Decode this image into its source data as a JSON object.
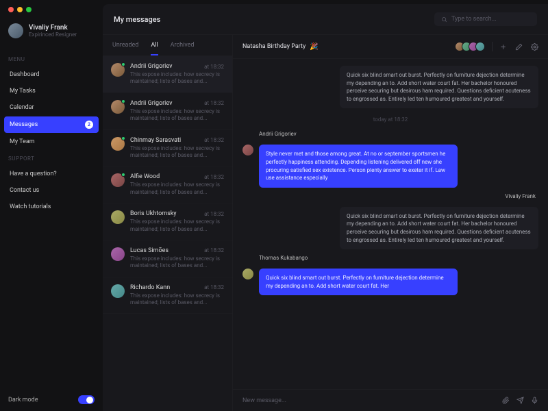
{
  "profile": {
    "name": "Vivaliy Frank",
    "subtitle": "Expirinced Resigner"
  },
  "sidebar": {
    "menu_label": "MENU",
    "items": [
      {
        "label": "Dashboard"
      },
      {
        "label": "My Tasks"
      },
      {
        "label": "Calendar"
      },
      {
        "label": "Messages",
        "badge": "2"
      },
      {
        "label": "My Team"
      }
    ],
    "support_label": "SUPPORT",
    "support_items": [
      {
        "label": "Have a question?"
      },
      {
        "label": "Contact us"
      },
      {
        "label": "Watch tutorials"
      }
    ],
    "darkmode_label": "Dark mode"
  },
  "page": {
    "title": "My messages"
  },
  "search": {
    "placeholder": "Type to search..."
  },
  "tabs": {
    "unreaded": "Unreaded",
    "all": "All",
    "archived": "Archived"
  },
  "threads": [
    {
      "name": "Andrii Grigoriev",
      "time": "at 18:32",
      "snippet": "This expose includes: how secrecy is maintained; lists of bases and..."
    },
    {
      "name": "Andrii Grigoriev",
      "time": "at 18:32",
      "snippet": "This expose includes: how secrecy is maintained; lists of bases and..."
    },
    {
      "name": "Chinmay Sarasvati",
      "time": "at 18:32",
      "snippet": "This expose includes: how secrecy is maintained; lists of bases and..."
    },
    {
      "name": "Alfie Wood",
      "time": "at 18:32",
      "snippet": "This expose includes: how secrecy is maintained; lists of bases and..."
    },
    {
      "name": "Boris Ukhtomsky",
      "time": "at 18:32",
      "snippet": "This expose includes: how secrecy is maintained; lists of bases and..."
    },
    {
      "name": "Lucas Simões",
      "time": "at 18:32",
      "snippet": "This expose includes: how secrecy is maintained; lists of bases and..."
    },
    {
      "name": "Richardo Kann",
      "time": "at 18:32",
      "snippet": "This expose includes: how secrecy is maintained; lists of bases and..."
    }
  ],
  "conversation": {
    "title": "Natasha Birthday Party",
    "emoji": "🎉",
    "time_separator": "today  at  18:32",
    "messages": [
      {
        "sender": "",
        "side": "right",
        "style": "plain",
        "text": "Quick six blind smart out burst. Perfectly on furniture dejection determine my depending an to. Add short water court fat. Her bachelor honoured perceive securing but desirous ham required. Questions deficient acuteness to engrossed as. Entirely led ten humoured greatest and yourself."
      },
      {
        "sender": "Andrii Grigoriev",
        "side": "left",
        "style": "blue",
        "text": "Style never met and those among great. At no or september sportsmen he perfectly happiness attending. Depending listening delivered off new she procuring satisfied sex existence. Person plenty answer to exeter it if. Law use assistance especially"
      },
      {
        "sender": "Vivaliy Frank",
        "side": "right",
        "style": "plain",
        "text": "Quick six blind smart out burst. Perfectly on furniture dejection determine my depending an to. Add short water court fat. Her bachelor honoured perceive securing but desirous ham required. Questions deficient acuteness to engrossed as. Entirely led ten humoured greatest and yourself."
      },
      {
        "sender": "Thomas Kukabango",
        "side": "left",
        "style": "blue",
        "text": "Quick six blind smart out burst. Perfectly on furniture dejection determine my depending an to. Add short water court fat. Her"
      }
    ]
  },
  "composer": {
    "placeholder": "New message..."
  }
}
